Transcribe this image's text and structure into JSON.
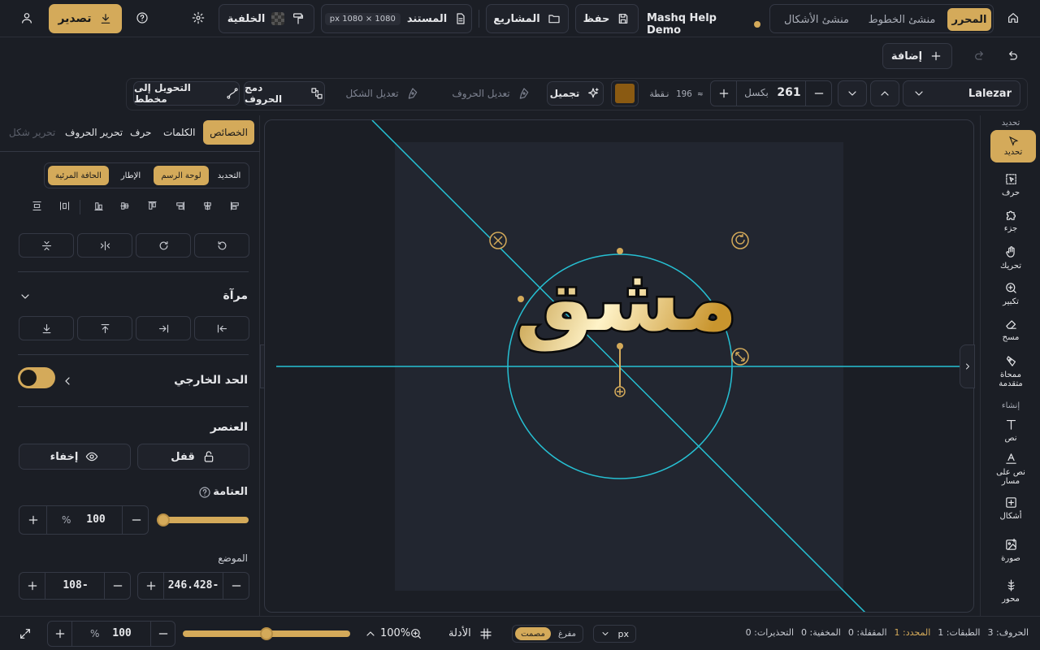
{
  "colors": {
    "accent": "#d4aa5a",
    "guide": "#26c0d3",
    "swatch": "#8a5a12"
  },
  "topbar": {
    "tabs": [
      "المحرر",
      "منشئ الخطوط",
      "منشئ الأشكال"
    ],
    "project_name": "Mashq Help Demo",
    "save_label": "حفظ",
    "projects_label": "المشاريع",
    "document_label": "المستند",
    "document_size": "px 1080 × 1080",
    "background_label": "الخلفية",
    "export_label": "تصدير"
  },
  "row2": {
    "add_label": "إضافة"
  },
  "toolbar": {
    "font_name": "Lalezar",
    "font_size": "261",
    "size_unit": "بكسل",
    "points": "≈ 196 نقطة",
    "beautify_label": "تجميل",
    "edit_letters_label": "تعديل الحروف",
    "edit_shape_label": "تعديل الشكل",
    "merge_letters_label": "دمج الحروف",
    "convert_path_label": "التحويل إلى مخطط"
  },
  "left_panel": {
    "tabs": [
      "الخصائص",
      "الكلمات",
      "حرف",
      "تحرير الحروف",
      "تحرير شكل"
    ],
    "ref_options": [
      "التحديد",
      "لوحة الرسم",
      "الإطار",
      "الحافة المرئية"
    ],
    "mirror_label": "مرآة",
    "outline_label": "الحد الخارجي",
    "element_label": "العنصر",
    "lock_label": "قفل",
    "hide_label": "إخفاء",
    "opacity_label": "العتامة",
    "opacity_value": "100",
    "opacity_unit": "%",
    "opacity_level": 0,
    "position_label": "الموضع",
    "position_x": "-246.428",
    "position_y": "-108"
  },
  "canvas": {
    "artwork_text": "مشق"
  },
  "rail": {
    "group_select": "تحديد",
    "items": [
      "تحديد",
      "حرف",
      "جزء",
      "تحريك",
      "تكبير",
      "مسح",
      "ممحاة متقدمة"
    ],
    "group_create": "إنشاء",
    "create_items": [
      "نص",
      "نص على مسار",
      "أشكال",
      "صورة",
      "محور"
    ]
  },
  "status": {
    "zoom_value": "100",
    "zoom_unit": "%",
    "zoom_slider": 0.5,
    "zoom_percent": "100%",
    "guides_label": "الأدلة",
    "mode_options": [
      "مصمت",
      "مفرغ"
    ],
    "unit": "px",
    "counters": [
      "الحروف: 3",
      "الطبقات: 1",
      "المحدد: 1",
      "المقفلة: 0",
      "المخفية: 0",
      "التحذيرات: 0"
    ]
  }
}
